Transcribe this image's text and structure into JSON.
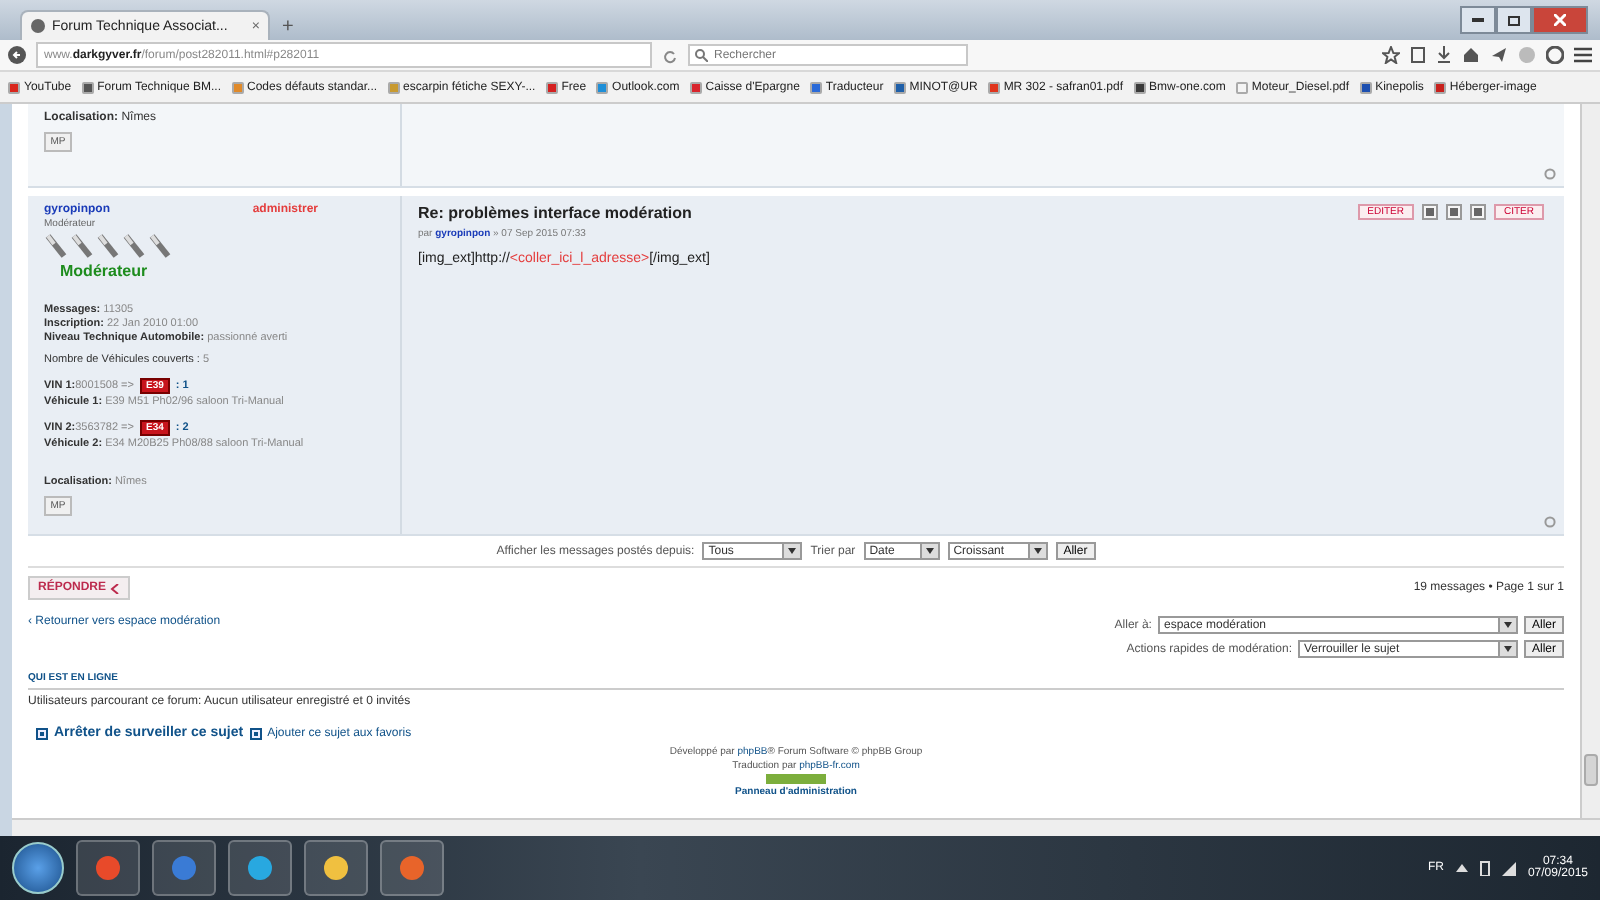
{
  "browser": {
    "tab_title": "Forum Technique Associat...",
    "tab_close": "×",
    "new_tab": "+",
    "url_host": "www.",
    "url_domain": "darkgyver.fr",
    "url_path": "/forum/post282011.html#p282011",
    "search_placeholder": "Rechercher"
  },
  "bookmarks": [
    {
      "label": "YouTube",
      "color": "#d9261c"
    },
    {
      "label": "Forum Technique BM...",
      "color": "#555555"
    },
    {
      "label": "Codes défauts standar...",
      "color": "#e08a2a"
    },
    {
      "label": "escarpin fétiche SEXY-...",
      "color": "#c89a30"
    },
    {
      "label": "Free",
      "color": "#d42020"
    },
    {
      "label": "Outlook.com",
      "color": "#1e8fd8"
    },
    {
      "label": "Caisse d'Epargne",
      "color": "#d8242c"
    },
    {
      "label": "Traducteur",
      "color": "#2a6ad8"
    },
    {
      "label": "MINOT@UR",
      "color": "#1f5fa8"
    },
    {
      "label": "MR 302 - safran01.pdf",
      "color": "#e0341c"
    },
    {
      "label": "Bmw-one.com",
      "color": "#3a3a3a"
    },
    {
      "label": "Moteur_Diesel.pdf",
      "color": "#f4f4f4"
    },
    {
      "label": "Kinepolis",
      "color": "#1c4fb0"
    },
    {
      "label": "Héberger-image",
      "color": "#c8201c"
    }
  ],
  "previous_post": {
    "location_label": "Localisation:",
    "location": "Nîmes",
    "pm_button": "MP"
  },
  "post": {
    "author": "gyropinpon",
    "admin_link": "administrer",
    "rank": "Modérateur",
    "rank_image_label": "Modérateur",
    "profile": [
      {
        "label": "Messages:",
        "value": "11305"
      },
      {
        "label": "Inscription:",
        "value": "22 Jan 2010 01:00"
      },
      {
        "label": "Niveau Technique Automobile:",
        "value": "passionné averti"
      }
    ],
    "vehicles_count": {
      "label": "Nombre de Véhicules couverts :",
      "value": "5"
    },
    "vehicles": [
      {
        "vin_label": "VIN 1:",
        "vin": "8001508",
        "arrow": "=>",
        "badge": "E39",
        "count": ": 1",
        "vehicle_label": "Véhicule 1:",
        "vehicle": "E39 M51 Ph02/96 saloon Tri-Manual"
      },
      {
        "vin_label": "VIN 2:",
        "vin": "3563782",
        "arrow": "=>",
        "badge": "E34",
        "count": ": 2",
        "vehicle_label": "Véhicule 2:",
        "vehicle": "E34 M20B25 Ph08/88 saloon Tri-Manual"
      }
    ],
    "location_label": "Localisation:",
    "location": "Nîmes",
    "pm_button": "MP",
    "title": "Re: problèmes interface modération",
    "meta_prefix": "par",
    "meta_author": "gyropinpon",
    "meta_date": "» 07 Sep 2015 07:33",
    "body_prefix": "[img_ext]http://",
    "body_link": "<coller_ici_l_adresse>",
    "body_suffix": "[/img_ext]",
    "actions": [
      {
        "kind": "text",
        "label": "EDITER"
      },
      {
        "kind": "icon"
      },
      {
        "kind": "icon"
      },
      {
        "kind": "icon"
      },
      {
        "kind": "text",
        "label": "CITER"
      }
    ]
  },
  "sort_bar": {
    "label": "Afficher les messages postés depuis:",
    "since": "Tous",
    "sort_label": "Trier par",
    "sort_key": "Date",
    "order": "Croissant",
    "go": "Aller"
  },
  "reply_button": "RÉPONDRE",
  "pagination": "19 messages • Page 1 sur 1",
  "return_link": "‹ Retourner vers espace modération",
  "jump": [
    {
      "label": "Aller à:",
      "value": "espace modération",
      "go": "Aller"
    },
    {
      "label": "Actions rapides de modération:",
      "value": "Verrouiller le sujet",
      "go": "Aller"
    }
  ],
  "online": {
    "heading": "QUI EST EN LIGNE",
    "text": "Utilisateurs parcourant ce forum: Aucun utilisateur enregistré et 0 invités"
  },
  "subscriptions": [
    {
      "label": "Arrêter de surveiller ce sujet",
      "bold": true
    },
    {
      "label": "Ajouter ce sujet aux favoris",
      "bold": false
    }
  ],
  "footer": {
    "line1_prefix": "Développé par",
    "line1_link": "phpBB",
    "line1_suffix": "® Forum Software © phpBB Group",
    "line2_prefix": "Traduction par",
    "line2_link": "phpBB-fr.com",
    "admin_link": "Panneau d'administration"
  },
  "taskbar": {
    "language": "FR",
    "time": "07:34",
    "date": "07/09/2015"
  }
}
